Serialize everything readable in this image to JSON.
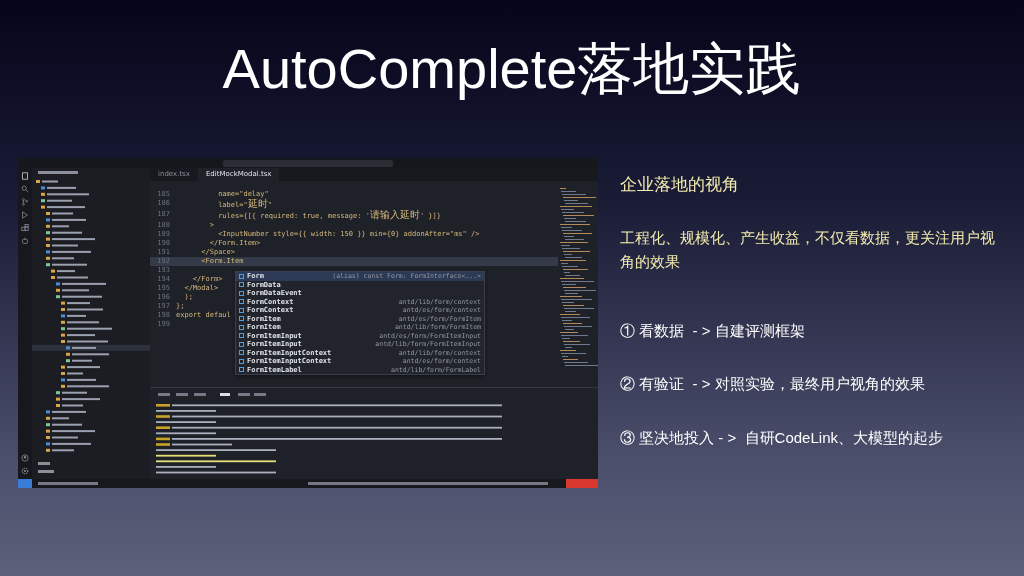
{
  "slide_title": "AutoComplete落地实践",
  "editor_window": {
    "tabs": [
      {
        "label": "index.tsx",
        "selected": false
      },
      {
        "label": "EditMockModal.tsx",
        "selected": true
      }
    ],
    "code_lines": [
      {
        "number": "185",
        "text": "          name=\"delay\"",
        "active": false
      },
      {
        "number": "186",
        "text": "          label=\"延时\"",
        "active": false
      },
      {
        "number": "187",
        "text": "          rules={[{ required: true, message: '请输入延时' }]}",
        "active": false
      },
      {
        "number": "188",
        "text": "        >",
        "active": false
      },
      {
        "number": "189",
        "text": "          <InputNumber style={{ width: 150 }} min={0} addonAfter=\"ms\" />",
        "active": false
      },
      {
        "number": "190",
        "text": "        </Form.Item>",
        "active": false
      },
      {
        "number": "191",
        "text": "      </Space>",
        "active": false
      },
      {
        "number": "192",
        "text": "      <Form.Item",
        "active": true
      },
      {
        "number": "193",
        "active": false
      },
      {
        "number": "194",
        "text": "    </Form>",
        "active": false
      },
      {
        "number": "195",
        "text": "  </Modal>",
        "active": false
      },
      {
        "number": "196",
        "text": "  );",
        "active": false
      },
      {
        "number": "197",
        "text": "};",
        "active": false
      },
      {
        "number": "198",
        "text": "export defaul",
        "active": false
      },
      {
        "number": "199",
        "active": false
      }
    ],
    "suggestions": [
      {
        "label": "Form",
        "detail": "(alias) const Form: FormInterface<...>",
        "selected": true
      },
      {
        "label": "FormData",
        "selected": false
      },
      {
        "label": "FormDataEvent",
        "selected": false
      },
      {
        "label": "FormContext",
        "detail": "antd/lib/form/context",
        "selected": false
      },
      {
        "label": "FormContext",
        "detail": "antd/es/form/context",
        "selected": false
      },
      {
        "label": "FormItem",
        "detail": "antd/es/form/FormItem",
        "selected": false
      },
      {
        "label": "FormItem",
        "detail": "antd/lib/form/FormItem",
        "selected": false
      },
      {
        "label": "FormItemInput",
        "detail": "antd/es/form/FormItemInput",
        "selected": false
      },
      {
        "label": "FormItemInput",
        "detail": "antd/lib/form/FormItemInput",
        "selected": false
      },
      {
        "label": "FormItemInputContext",
        "detail": "antd/lib/form/context",
        "selected": false
      },
      {
        "label": "FormItemInputContext",
        "detail": "antd/es/form/context",
        "selected": false
      },
      {
        "label": "FormItemLabel",
        "detail": "antd/lib/form/FormLabel",
        "selected": false
      }
    ]
  },
  "heading": "企业落地的视角",
  "intro": "工程化、规模化、产生收益，不仅看数据，更关注用户视角的效果",
  "points": [
    "① 看数据  - > 自建评测框架",
    "② 有验证  - > 对照实验，最终用户视角的效果",
    "③ 坚决地投入 - >  自研CodeLink、大模型的起步"
  ]
}
